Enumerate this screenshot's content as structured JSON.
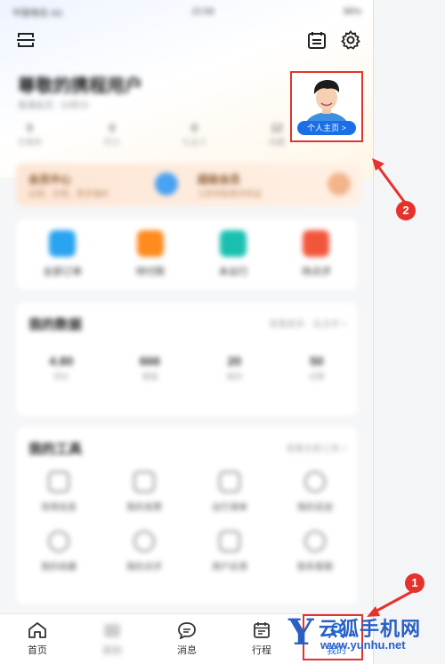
{
  "status_bar": {
    "carrier": "中国电信 4G",
    "time": "22:58",
    "battery": "88%"
  },
  "header": {
    "user_name": "尊敬的携程用户",
    "user_sub": "普通会员 · 60积分"
  },
  "stats": [
    {
      "value": "0",
      "label": "优惠券"
    },
    {
      "value": "0",
      "label": "积分"
    },
    {
      "value": "0",
      "label": "礼品卡"
    },
    {
      "value": "12",
      "label": "收藏"
    }
  ],
  "avatar": {
    "label": "个人主页 >"
  },
  "banner": {
    "left_title": "会员中心",
    "left_sub": "出游、住宿，更多福利",
    "right_title": "超级会员",
    "right_sub": "立即领取更多权益"
  },
  "quick_actions": [
    {
      "label": "全部订单",
      "color": "#2aa3f0"
    },
    {
      "label": "待付款",
      "color": "#ff8a1e"
    },
    {
      "label": "未出行",
      "color": "#19c0b0"
    },
    {
      "label": "待点评",
      "color": "#f2563a"
    }
  ],
  "my_data": {
    "title": "我的数据",
    "right": "查看更多 · 去点评 >",
    "cells": [
      {
        "value": "4.80",
        "label": "评价"
      },
      {
        "value": "666",
        "label": "里程"
      },
      {
        "value": "20",
        "label": "城市"
      },
      {
        "value": "50",
        "label": "点赞"
      }
    ]
  },
  "my_tools": {
    "title": "我的工具",
    "right": "查看全部工具 >",
    "items": [
      "常用信息",
      "我的发票",
      "出行清单",
      "我的足迹",
      "我的收藏",
      "我的点评",
      "用户反馈",
      "联系客服"
    ]
  },
  "tabs": [
    {
      "label": "首页",
      "icon": "home-icon"
    },
    {
      "label": "旅拍",
      "icon": "photo-icon"
    },
    {
      "label": "消息",
      "icon": "message-icon"
    },
    {
      "label": "行程",
      "icon": "calendar-icon"
    },
    {
      "label": "我的",
      "icon": "profile-icon"
    }
  ],
  "callouts": [
    "1",
    "2"
  ],
  "watermark": {
    "logo": "Y",
    "title": "云狐手机网",
    "url": "www.yunhu.net"
  },
  "colors": {
    "accent": "#1a6fe6",
    "highlight": "#e5322d",
    "watermark": "#2a5fc4"
  }
}
